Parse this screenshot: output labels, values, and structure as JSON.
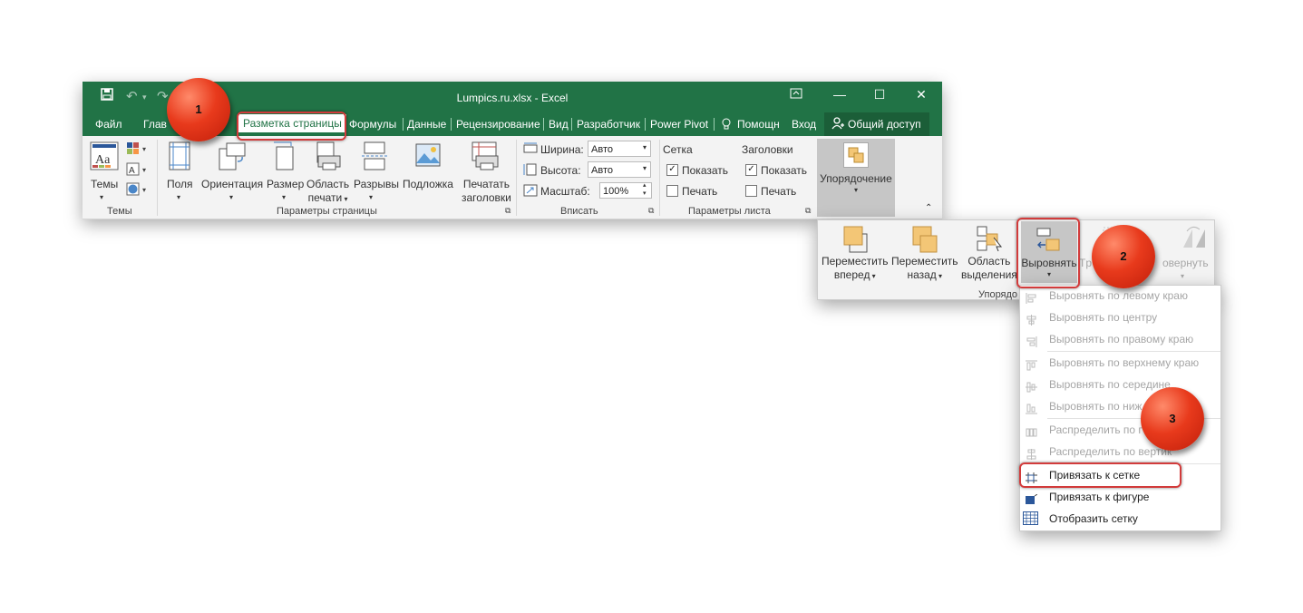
{
  "window": {
    "title": "Lumpics.ru.xlsx - Excel",
    "accent": "#217346"
  },
  "tabs": [
    {
      "label": "Файл"
    },
    {
      "label": "Глав"
    },
    {
      "label": "Разметка страницы"
    },
    {
      "label": "Формулы"
    },
    {
      "label": "Данные"
    },
    {
      "label": "Рецензирование"
    },
    {
      "label": "Вид"
    },
    {
      "label": "Разработчик"
    },
    {
      "label": "Power Pivot"
    },
    {
      "label": "Помощн"
    },
    {
      "label": "Вход"
    },
    {
      "label": "Общий доступ"
    }
  ],
  "ribbon": {
    "themes": {
      "label": "Темы",
      "group": "Темы"
    },
    "page_setup": {
      "fields": "Поля",
      "orientation": "Ориентация",
      "size": "Размер",
      "print_area_1": "Область",
      "print_area_2": "печати",
      "breaks": "Разрывы",
      "background": "Подложка",
      "print_titles_1": "Печатать",
      "print_titles_2": "заголовки",
      "group": "Параметры страницы"
    },
    "scale": {
      "width_label": "Ширина:",
      "width_value": "Авто",
      "height_label": "Высота:",
      "height_value": "Авто",
      "scale_label": "Масштаб:",
      "scale_value": "100%",
      "group": "Вписать"
    },
    "sheet_options": {
      "gridlines": "Сетка",
      "headings": "Заголовки",
      "show": "Показать",
      "print": "Печать",
      "group": "Параметры листа"
    },
    "arrange": {
      "label": "Упорядочение"
    }
  },
  "arrange_panel": {
    "bring_forward_1": "Переместить",
    "bring_forward_2": "вперед",
    "send_backward_1": "Переместить",
    "send_backward_2": "назад",
    "selection_pane_1": "Область",
    "selection_pane_2": "выделения",
    "align": "Выровнять",
    "group_partial": "Tp",
    "rotate_partial": "овернуть",
    "group_label": "Упорядо"
  },
  "menu": {
    "items": [
      {
        "label": "Выровнять по левому краю",
        "enabled": false
      },
      {
        "label": "Выровнять по центру",
        "enabled": false
      },
      {
        "label": "Выровнять по правому краю",
        "enabled": false
      },
      {
        "label": "Выровнять по верхнему краю",
        "enabled": false
      },
      {
        "label": "Выровнять по середине",
        "enabled": false
      },
      {
        "label": "Выровнять по ниж",
        "enabled": false
      },
      {
        "label": "Распределить по г",
        "enabled": false
      },
      {
        "label": "Распределить по вертик",
        "enabled": false
      },
      {
        "label": "Привязать к сетке",
        "enabled": true
      },
      {
        "label": "Привязать к фигуре",
        "enabled": true
      },
      {
        "label": "Отобразить сетку",
        "enabled": true
      }
    ]
  },
  "badges": [
    "1",
    "2",
    "3"
  ]
}
